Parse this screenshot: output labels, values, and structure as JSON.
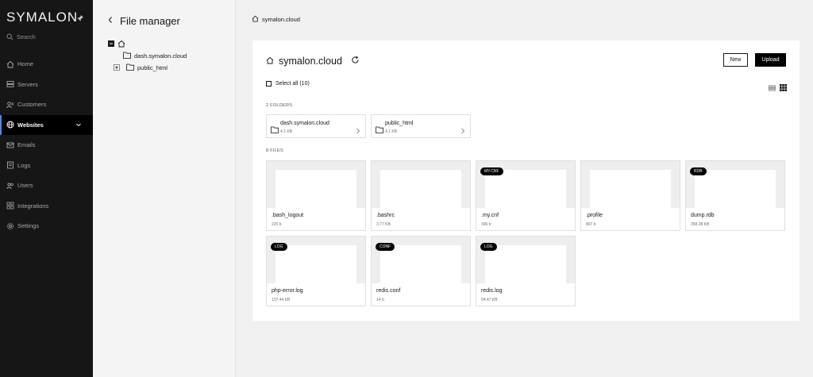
{
  "sidebar": {
    "brand": "SYMALON",
    "search_label": "Search",
    "items": [
      {
        "label": "Home",
        "icon": "home-icon"
      },
      {
        "label": "Servers",
        "icon": "server-icon"
      },
      {
        "label": "Customers",
        "icon": "customers-icon"
      },
      {
        "label": "Websites",
        "icon": "globe-icon",
        "active": true
      },
      {
        "label": "Emails",
        "icon": "email-icon"
      },
      {
        "label": "Logs",
        "icon": "logs-icon"
      },
      {
        "label": "Users",
        "icon": "users-icon"
      },
      {
        "label": "Integrations",
        "icon": "integrations-icon"
      },
      {
        "label": "Settings",
        "icon": "settings-icon"
      }
    ]
  },
  "tree": {
    "title": "File manager",
    "items": [
      {
        "label": "dash.symalon.cloud"
      },
      {
        "label": "public_html"
      }
    ]
  },
  "breadcrumb": {
    "label": "symalon.cloud"
  },
  "main": {
    "title": "symalon.cloud",
    "new_label": "New",
    "upload_label": "Upload",
    "select_all_label": "Select all (10)",
    "folders_label": "2 FOLDERS",
    "files_label": "8 FILES",
    "folders": [
      {
        "name": "dash.symalon.cloud",
        "size": "4.1 KB"
      },
      {
        "name": "public_html",
        "size": "4.1 KB"
      }
    ],
    "files": [
      {
        "name": ".bash_logout",
        "size": "220 b",
        "tag": ""
      },
      {
        "name": ".bashrc",
        "size": "3.77 KB",
        "tag": ""
      },
      {
        "name": ".my.cnf",
        "size": "396 b",
        "tag": "MY.CNF"
      },
      {
        "name": ".profile",
        "size": "807 b",
        "tag": ""
      },
      {
        "name": "dump.rdb",
        "size": "358.08 KB",
        "tag": "RDB"
      },
      {
        "name": "php-error.log",
        "size": "137.44 KB",
        "tag": "LOG"
      },
      {
        "name": "redis.conf",
        "size": "14 b",
        "tag": "CONF"
      },
      {
        "name": "redis.log",
        "size": "94.47 KB",
        "tag": "LOG"
      }
    ]
  },
  "colors": {
    "sidebar_bg": "#161616",
    "active_bg": "#000000",
    "accent": "#4589ff",
    "primary_button": "#000000"
  }
}
